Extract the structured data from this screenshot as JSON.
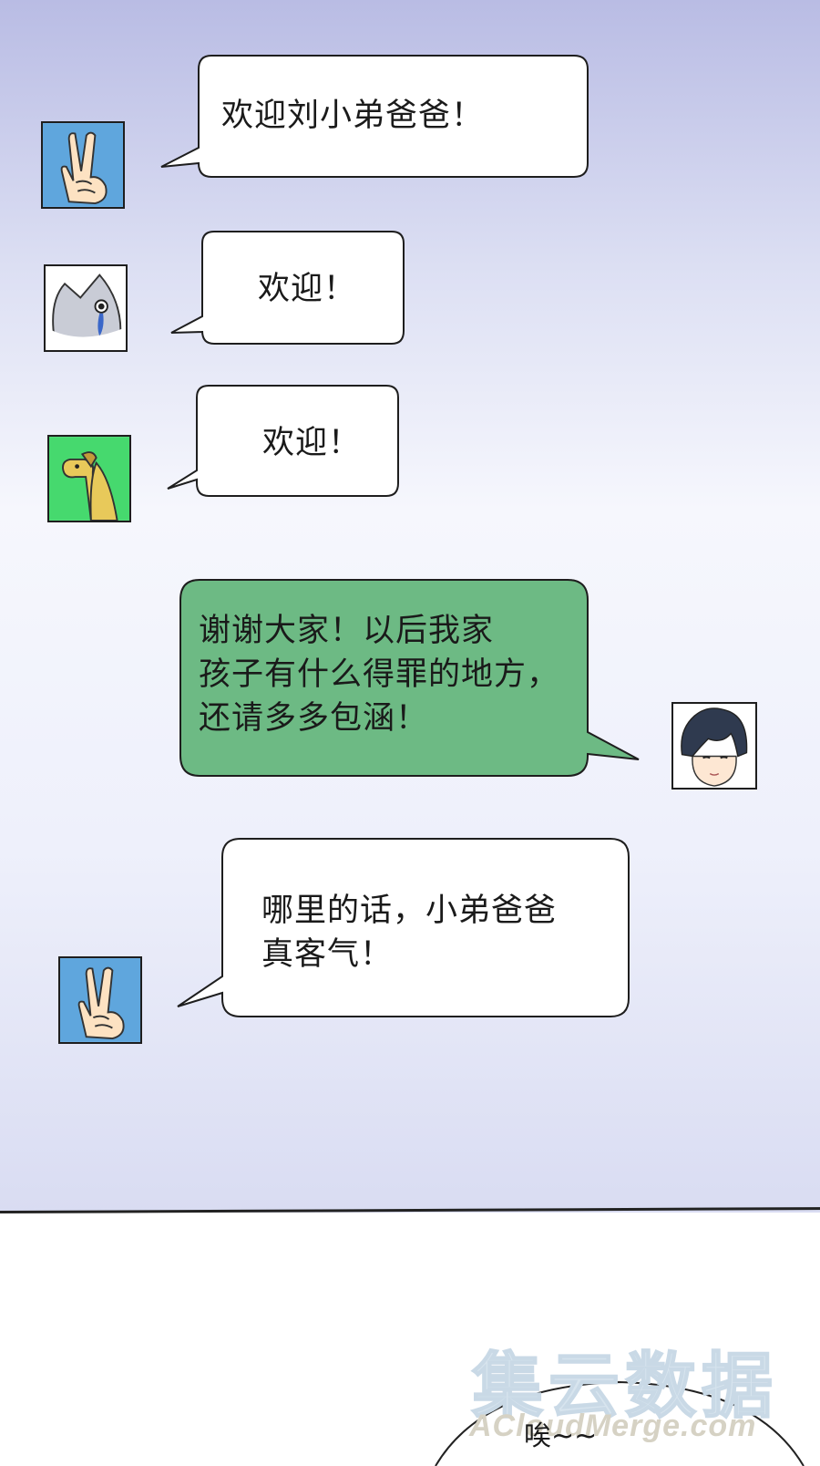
{
  "messages": [
    {
      "text": "欢迎刘小弟爸爸！",
      "avatar": "peace-hand-icon"
    },
    {
      "text": "欢迎！",
      "avatar": "crying-cat-icon"
    },
    {
      "text": "欢迎！",
      "avatar": "yellow-dino-icon"
    },
    {
      "text": "谢谢大家！以后我家\n孩子有什么得罪的地方，\n还请多多包涵！",
      "avatar": "dark-haired-man-avatar"
    },
    {
      "text": "哪里的话，小弟爸爸\n真客气！",
      "avatar": "peace-hand-icon"
    }
  ],
  "bottom_text": "唉~~",
  "watermark": {
    "cn": "集云数据",
    "en": "ACloudMerge.com"
  },
  "colors": {
    "bubble_fill": "#ffffff",
    "own_bubble_fill": "#6dba84",
    "outline": "#1e1e1e",
    "peace_bg": "#5fa6dd",
    "dino_bg": "#46d96e"
  }
}
